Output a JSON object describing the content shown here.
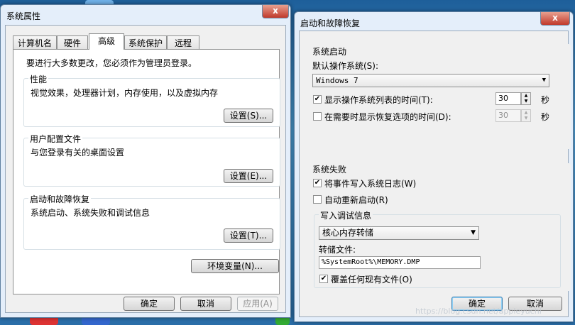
{
  "sysprops": {
    "title": "系统属性",
    "tabs": [
      "计算机名",
      "硬件",
      "高级",
      "系统保护",
      "远程"
    ],
    "admin_note": "要进行大多数更改，您必须作为管理员登录。",
    "performance": {
      "title": "性能",
      "desc": "视觉效果，处理器计划，内存使用，以及虚拟内存",
      "btn": "设置(S)..."
    },
    "profile": {
      "title": "用户配置文件",
      "desc": "与您登录有关的桌面设置",
      "btn": "设置(E)..."
    },
    "startup": {
      "title": "启动和故障恢复",
      "desc": "系统启动、系统失败和调试信息",
      "btn": "设置(T)..."
    },
    "env_btn": "环境变量(N)...",
    "ok": "确定",
    "cancel": "取消",
    "apply": "应用(A)"
  },
  "recovery": {
    "title": "启动和故障恢复",
    "close": "x",
    "startup_group": "系统启动",
    "default_os_label": "默认操作系统(S):",
    "default_os_value": "Windows 7",
    "show_list_label": "显示操作系统列表的时间(T):",
    "show_list_checked": true,
    "show_list_value": "30",
    "show_recovery_label": "在需要时显示恢复选项的时间(D):",
    "show_recovery_checked": false,
    "show_recovery_value": "30",
    "seconds": "秒",
    "failure_group": "系统失败",
    "write_log_label": "将事件写入系统日志(W)",
    "write_log_checked": true,
    "auto_restart_label": "自动重新启动(R)",
    "auto_restart_checked": false,
    "debug_group": "写入调试信息",
    "debug_value": "核心内存转储",
    "dump_label": "转储文件:",
    "dump_value": "%SystemRoot%\\MEMORY.DMP",
    "overwrite_label": "覆盖任何现有文件(O)",
    "overwrite_checked": true,
    "ok": "确定",
    "cancel": "取消"
  },
  "watermark": "https://blog.csdn.net/appleyuchi",
  "icons": {
    "check": "✔",
    "dropdown": "▼",
    "up": "▲",
    "down": "▼",
    "question": "?"
  }
}
